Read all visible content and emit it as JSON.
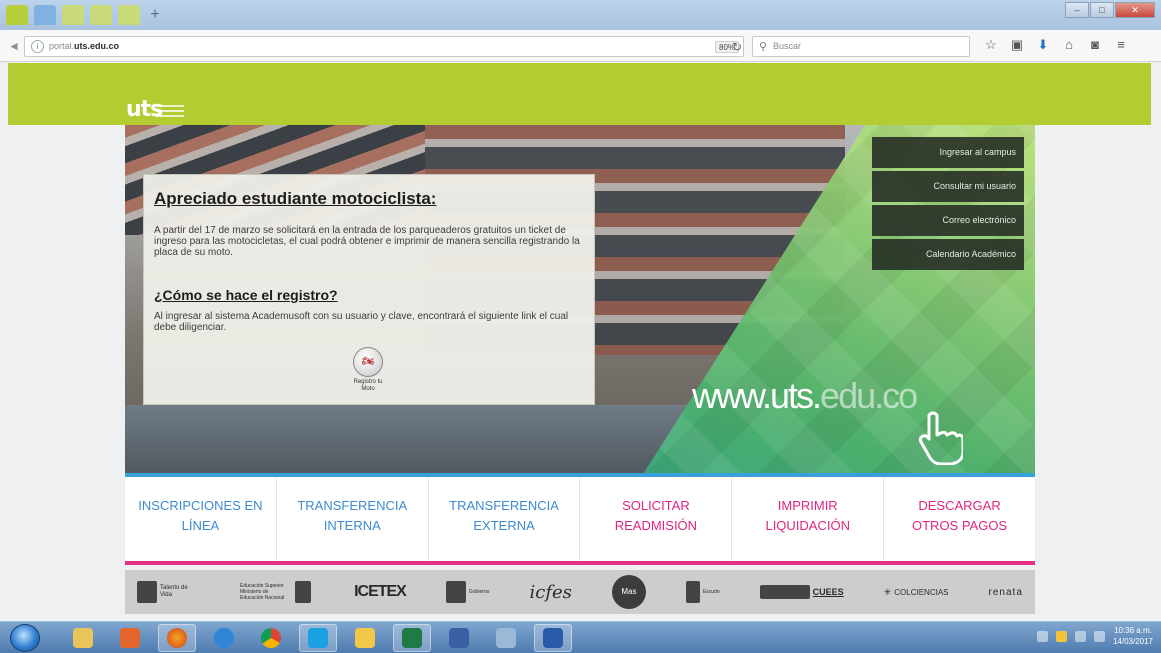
{
  "browser": {
    "url_prefix": "portal.",
    "url_domain": "uts.edu.co",
    "zoom": "80%",
    "search_placeholder": "Buscar"
  },
  "header": {
    "logo_text": "uts"
  },
  "quick_links": [
    {
      "label": "Ingresar al campus"
    },
    {
      "label": "Consultar mi usuario"
    },
    {
      "label": "Correo electrónico"
    },
    {
      "label": "Calendario Académico"
    }
  ],
  "hero": {
    "url_main": "www.uts.",
    "url_tail": "edu.co"
  },
  "notice": {
    "title": "Apreciado estudiante motociclista:",
    "paragraph1": "A partir del 17 de marzo se solicitará en la entrada de los parqueaderos gratuitos un ticket de ingreso para las motocicletas, el cual podrá obtener e imprimir de manera sencilla registrando la placa de su moto.",
    "subtitle": "¿Cómo se hace el registro?",
    "paragraph2": "Al ingresar al sistema Academusoft con su usuario y clave, encontrará el siguiente link el cual debe diligenciar.",
    "button_label": "Registro tu Moto"
  },
  "action_links": [
    {
      "line1": "INSCRIPCIONES EN",
      "line2": "LÍNEA",
      "color": "#3d8bcf"
    },
    {
      "line1": "TRANSFERENCIA",
      "line2": "INTERNA",
      "color": "#3d8bcf"
    },
    {
      "line1": "TRANSFERENCIA",
      "line2": "EXTERNA",
      "color": "#3d8bcf"
    },
    {
      "line1": "SOLICITAR",
      "line2": "READMISIÓN",
      "color": "#e0257e"
    },
    {
      "line1": "IMPRIMIR",
      "line2": "LIQUIDACIÓN",
      "color": "#e0257e"
    },
    {
      "line1": "DESCARGAR",
      "line2": "OTROS PAGOS",
      "color": "#e0257e"
    }
  ],
  "partners": [
    {
      "name": "Talento de Vida"
    },
    {
      "name": "Educación Superior Ministerio de Educación Nacional"
    },
    {
      "name": "ICETEX"
    },
    {
      "name": "Gobierno"
    },
    {
      "name": "icfes"
    },
    {
      "name": "Mas"
    },
    {
      "name": "Escudo"
    },
    {
      "name": "CUEES"
    },
    {
      "name": "COLCIENCIAS"
    },
    {
      "name": "renata"
    }
  ],
  "taskbar": {
    "time": "10:36 a.m.",
    "date": "14/03/2017"
  },
  "colors": {
    "header_green": "#b3cc32",
    "link_blue": "#3d8bcf",
    "link_pink": "#e0257e"
  }
}
